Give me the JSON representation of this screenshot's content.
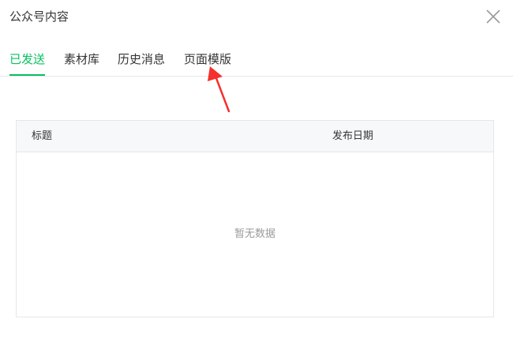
{
  "dialog": {
    "title": "公众号内容"
  },
  "tabs": [
    {
      "label": "已发送",
      "active": true
    },
    {
      "label": "素材库",
      "active": false
    },
    {
      "label": "历史消息",
      "active": false
    },
    {
      "label": "页面模版",
      "active": false
    }
  ],
  "table": {
    "columns": [
      "标题",
      "发布日期"
    ],
    "empty_text": "暂无数据"
  },
  "icons": {
    "close": "close-icon",
    "annotation": "red-arrow-icon"
  },
  "colors": {
    "accent": "#07c160",
    "annotation": "#f5302e"
  }
}
